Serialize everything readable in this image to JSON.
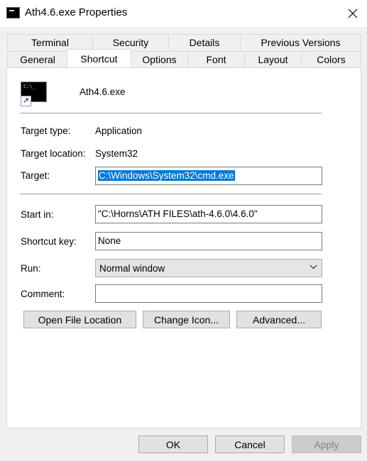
{
  "window": {
    "title": "Ath4.6.exe Properties",
    "close_icon": "close-icon",
    "app_icon": "console-icon"
  },
  "tabs": {
    "row1": [
      "Terminal",
      "Security",
      "Details",
      "Previous Versions"
    ],
    "row2": [
      "General",
      "Shortcut",
      "Options",
      "Font",
      "Layout",
      "Colors"
    ],
    "active": "Shortcut"
  },
  "shortcut": {
    "icon": "console-shortcut-icon",
    "icon_text": "C:\\_",
    "file_name": "Ath4.6.exe",
    "target_type_label": "Target type:",
    "target_type_value": "Application",
    "target_location_label": "Target location:",
    "target_location_value": "System32",
    "target_label": "Target:",
    "target_value": "C:\\Windows\\System32\\cmd.exe",
    "start_in_label": "Start in:",
    "start_in_value": "\"C:\\Horns\\ATH FILES\\ath-4.6.0\\4.6.0\"",
    "shortcut_key_label": "Shortcut key:",
    "shortcut_key_value": "None",
    "run_label": "Run:",
    "run_value": "Normal window",
    "comment_label": "Comment:",
    "comment_value": "",
    "open_file_location": "Open File Location",
    "change_icon": "Change Icon...",
    "advanced": "Advanced..."
  },
  "footer": {
    "ok": "OK",
    "cancel": "Cancel",
    "apply": "Apply"
  },
  "colors": {
    "selection": "#0078d7",
    "window_bg": "#f0f0f0",
    "panel_bg": "#ffffff"
  }
}
